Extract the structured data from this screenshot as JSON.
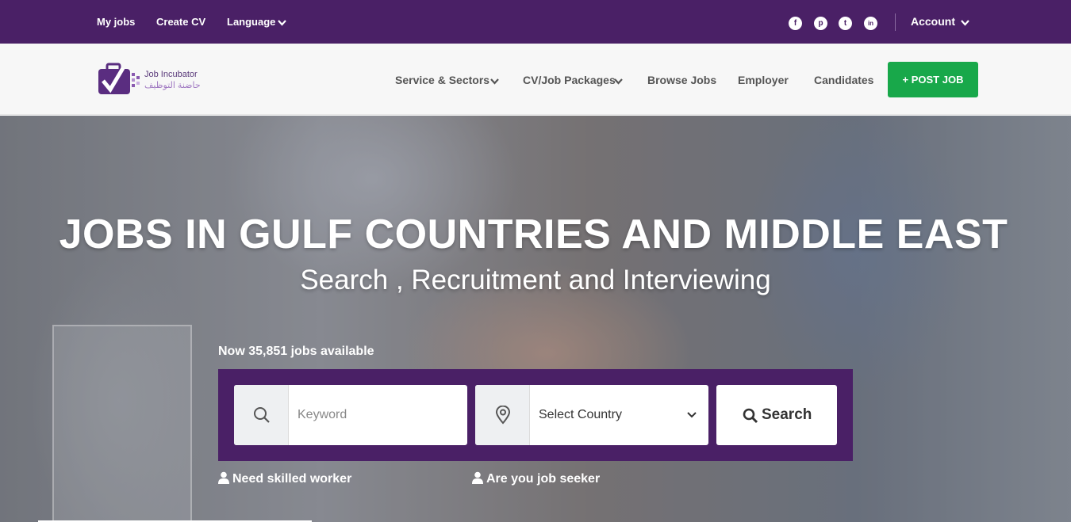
{
  "topbar": {
    "links": [
      "My jobs",
      "Create CV",
      "Language"
    ],
    "social": [
      {
        "name": "facebook-icon",
        "glyph": "f"
      },
      {
        "name": "pinterest-icon",
        "glyph": "p"
      },
      {
        "name": "twitter-icon",
        "glyph": "t"
      },
      {
        "name": "linkedin-icon",
        "glyph": "in"
      }
    ],
    "account": "Account",
    "bg_color": "#4a2066"
  },
  "header": {
    "logo_text_en": "Job Incubator",
    "logo_text_ar": "حاضنة التوظيف",
    "nav": [
      "Service & Sectors",
      "CV/Job Packages",
      "Browse Jobs",
      "Employer",
      "Candidates"
    ],
    "post_job": "+ POST JOB",
    "post_job_color": "#18a84a"
  },
  "hero": {
    "title": "JOBS IN GULF COUNTRIES AND MIDDLE EAST",
    "subtitle": "Search , Recruitment and Interviewing",
    "jobs_count": "Now 35,851 jobs available",
    "search": {
      "keyword_placeholder": "Keyword",
      "country_value": "Select Country",
      "button_label": "Search"
    },
    "links": [
      "Need skilled worker",
      "Are you job seeker"
    ]
  }
}
